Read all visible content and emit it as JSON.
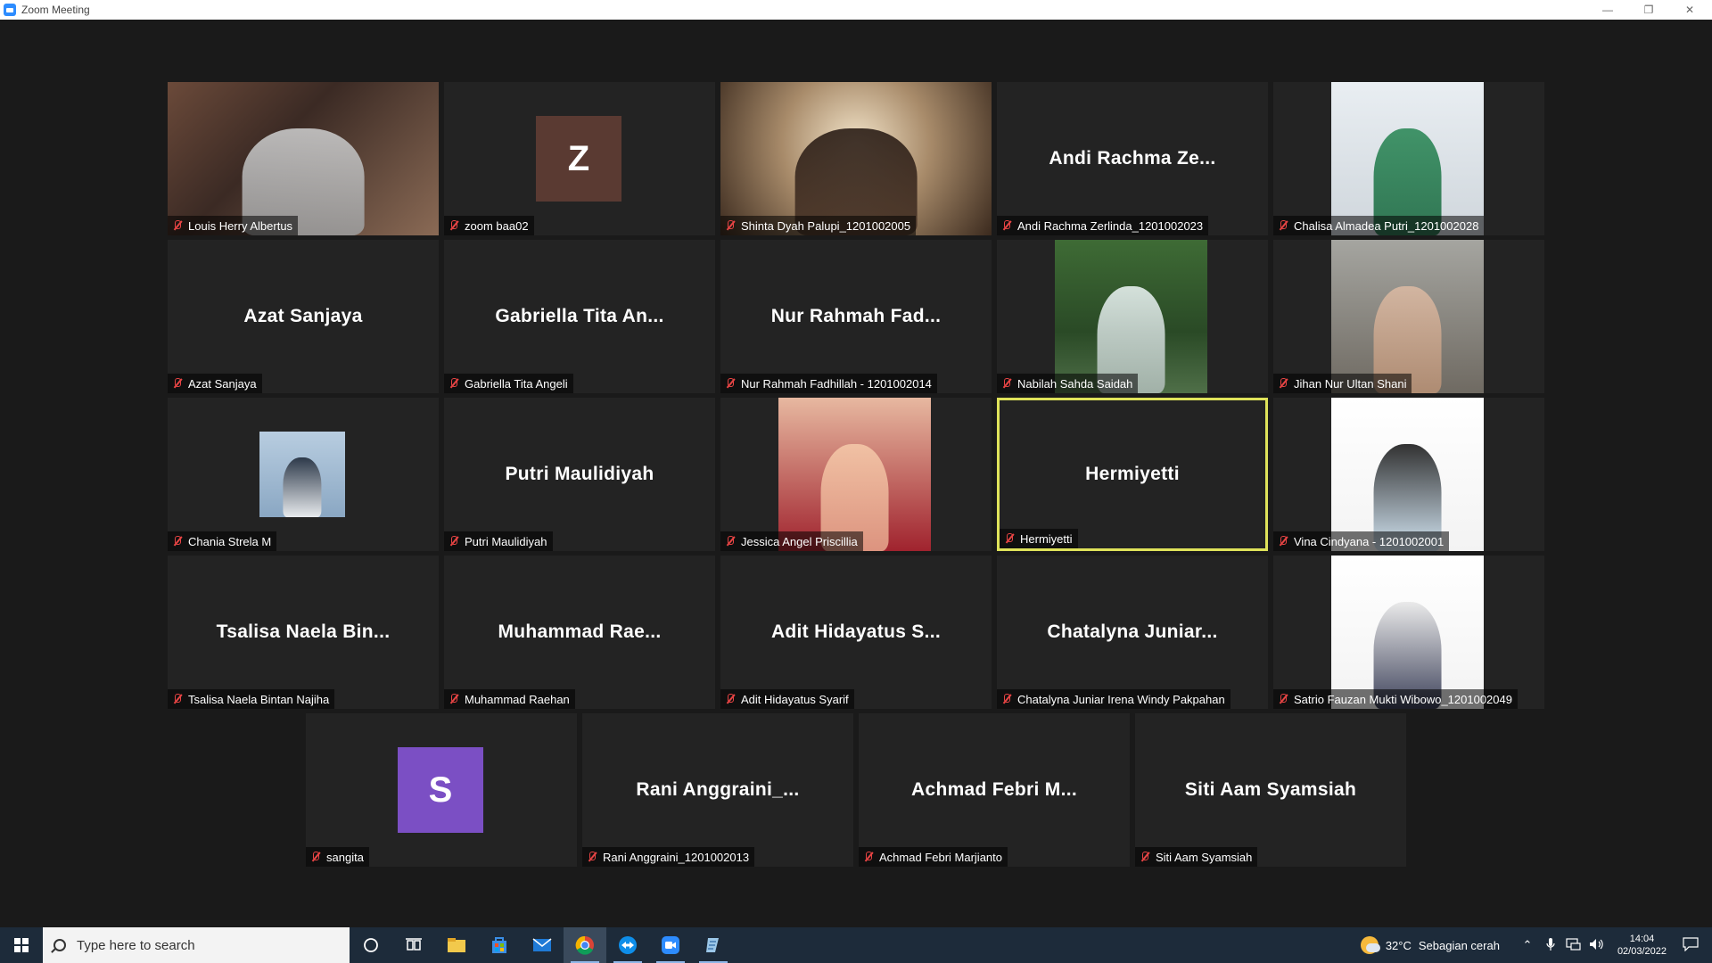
{
  "window": {
    "title": "Zoom Meeting"
  },
  "colors": {
    "active_speaker_border": "#dfe35a",
    "muted_mic": "#e74444",
    "stage_bg": "#1a1a1a",
    "tile_bg": "#232323"
  },
  "participants": [
    {
      "name": "Louis Herry Albertus",
      "display": "video"
    },
    {
      "name": "zoom baa02",
      "display": "letter",
      "letter": "Z",
      "avatar_color": "#5a3a32"
    },
    {
      "name": "Shinta Dyah Palupi_1201002005",
      "display": "video"
    },
    {
      "name": "Andi Rachma Zerlinda_1201002023",
      "display": "name",
      "short": "Andi Rachma Ze..."
    },
    {
      "name": "Chalisa Almadea Putri_1201002028",
      "display": "photo"
    },
    {
      "name": "Azat Sanjaya",
      "display": "name",
      "short": "Azat Sanjaya"
    },
    {
      "name": "Gabriella Tita Angeli",
      "display": "name",
      "short": "Gabriella Tita An..."
    },
    {
      "name": "Nur Rahmah Fadhillah - 1201002014",
      "display": "name",
      "short": "Nur Rahmah Fad..."
    },
    {
      "name": "Nabilah Sahda Saidah",
      "display": "photo"
    },
    {
      "name": "Jihan Nur Ultan Shani",
      "display": "photo"
    },
    {
      "name": "Chania Strela M",
      "display": "photo"
    },
    {
      "name": "Putri Maulidiyah",
      "display": "name",
      "short": "Putri Maulidiyah"
    },
    {
      "name": "Jessica Angel Priscillia",
      "display": "photo"
    },
    {
      "name": "Hermiyetti",
      "display": "name",
      "short": "Hermiyetti",
      "active": true
    },
    {
      "name": "Vina Cindyana - 1201002001",
      "display": "photo"
    },
    {
      "name": "Tsalisa Naela Bintan Najiha",
      "display": "name",
      "short": "Tsalisa Naela Bin..."
    },
    {
      "name": "Muhammad Raehan",
      "display": "name",
      "short": "Muhammad Rae..."
    },
    {
      "name": "Adit Hidayatus Syarif",
      "display": "name",
      "short": "Adit Hidayatus S..."
    },
    {
      "name": "Chatalyna Juniar Irena Windy Pakpahan",
      "display": "name",
      "short": "Chatalyna Juniar..."
    },
    {
      "name": "Satrio Fauzan Mukti Wibowo_1201002049",
      "display": "photo"
    },
    {
      "name": "sangita",
      "display": "letter",
      "letter": "S",
      "avatar_color": "#7b4fc4"
    },
    {
      "name": "Rani Anggraini_1201002013",
      "display": "name",
      "short": "Rani Anggraini_..."
    },
    {
      "name": "Achmad Febri Marjianto",
      "display": "name",
      "short": "Achmad Febri M..."
    },
    {
      "name": "Siti Aam Syamsiah",
      "display": "name",
      "short": "Siti Aam Syamsiah"
    }
  ],
  "taskbar": {
    "search_placeholder": "Type here to search",
    "apps": [
      "cortana-icon",
      "task-view-icon",
      "file-explorer-icon",
      "store-icon",
      "mail-icon",
      "chrome-icon",
      "teamviewer-icon",
      "zoom-icon",
      "notepad-icon"
    ],
    "weather": {
      "temp": "32°C",
      "desc": "Sebagian cerah"
    },
    "time": "14:04",
    "date": "02/03/2022"
  }
}
